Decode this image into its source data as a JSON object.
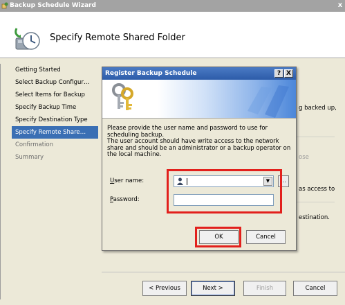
{
  "wizard": {
    "title": "Backup Schedule Wizard",
    "close_glyph": "x",
    "header_title": "Specify Remote Shared Folder",
    "nav_items": [
      {
        "label": "Getting Started",
        "state": "normal"
      },
      {
        "label": "Select Backup Configur…",
        "state": "normal"
      },
      {
        "label": "Select Items for Backup",
        "state": "normal"
      },
      {
        "label": "Specify Backup Time",
        "state": "normal"
      },
      {
        "label": "Specify Destination Type",
        "state": "normal"
      },
      {
        "label": "Specify Remote Share…",
        "state": "active"
      },
      {
        "label": "Confirmation",
        "state": "disabled"
      },
      {
        "label": "Summary",
        "state": "disabled"
      }
    ],
    "behind_text": {
      "line1": "g backed up,",
      "line2": "ose",
      "line3": "as access to",
      "line4": "estination."
    },
    "buttons": {
      "previous": "< Previous",
      "next": "Next >",
      "finish": "Finish",
      "cancel": "Cancel"
    }
  },
  "dialog": {
    "title": "Register Backup Schedule",
    "help_glyph": "?",
    "close_glyph": "X",
    "description_lines": [
      "Please provide the user name and password to use for",
      "scheduling backup.",
      "The user account should have write access to the network",
      "share and should be an administrator or a backup operator on",
      "the local machine."
    ],
    "user_name_label": "User name:",
    "user_name_label_rest": "ser name:",
    "password_label_rest": "assword:",
    "user_name_value": "",
    "password_value": "",
    "browse_label": "...",
    "ok_label": "OK",
    "cancel_label": "Cancel"
  },
  "colors": {
    "highlight": "#e2201c",
    "active_nav": "#3a6fb4",
    "dialog_title": "#2d5ca9"
  }
}
